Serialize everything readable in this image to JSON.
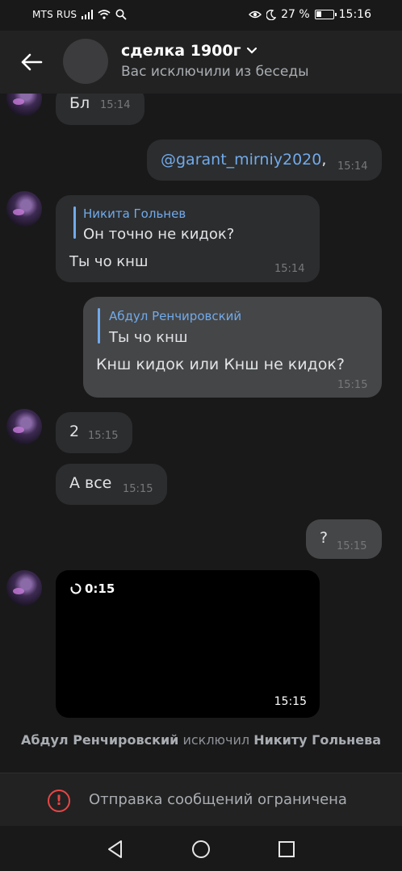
{
  "status_bar": {
    "carrier": "MTS RUS",
    "battery": "27 %",
    "battery_level": 0.27,
    "time": "15:16"
  },
  "header": {
    "title": "сделка 1900г",
    "subtitle": "Вас исключили из беседы",
    "back_icon": "arrow-left-icon",
    "dropdown_icon": "chevron-down-icon"
  },
  "messages": [
    {
      "side": "in",
      "text": "Бл",
      "time": "15:14"
    },
    {
      "side": "out",
      "mention": "@garant_mirniy2020",
      "suffix": ",",
      "time": "15:14"
    },
    {
      "side": "in",
      "reply_name": "Никита Гольнев",
      "reply_text": "Он точно не кидок?",
      "text": "Ты чо кнш",
      "time": "15:14"
    },
    {
      "side": "out",
      "reply_name": "Абдул Ренчировский",
      "reply_text": "Ты чо кнш",
      "text": "Кнш кидок или Кнш не кидок?",
      "time": "15:15"
    },
    {
      "side": "in",
      "text": "2",
      "time": "15:15"
    },
    {
      "side": "in",
      "text": "А все",
      "time": "15:15"
    },
    {
      "side": "out",
      "text": "?",
      "time": "15:15"
    },
    {
      "side": "in",
      "type": "video",
      "duration": "0:15",
      "time": "15:15"
    }
  ],
  "service_message": {
    "actor": "Абдул Ренчировский",
    "action": "исключил",
    "target": "Никиту Гольнева"
  },
  "restricted_bar": {
    "text": "Отправка сообщений ограничена",
    "icon": "warning-icon"
  },
  "nav_bar": {
    "back_icon": "nav-back-icon",
    "home_icon": "nav-home-icon",
    "recents_icon": "nav-recents-icon"
  },
  "colors": {
    "background": "#19191a",
    "header": "#222222",
    "bubble_in": "#2c2d2e",
    "bubble_out": "#454647",
    "accent": "#71aaeb",
    "warning": "#e64646"
  }
}
